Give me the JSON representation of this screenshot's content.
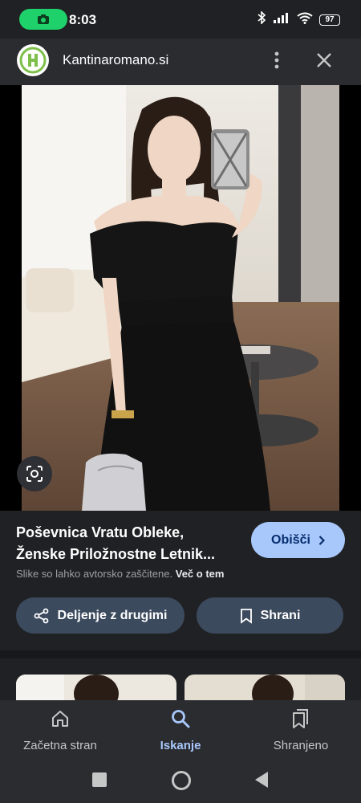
{
  "status_bar": {
    "time": "8:03",
    "battery": "97"
  },
  "header": {
    "site_name": "Kantinaromano.si"
  },
  "result": {
    "title_line1": "Poševnica Vratu Obleke,",
    "title_line2": "Ženske Priložnostne Letnik...",
    "visit_label": "Obišči",
    "copyright_text": "Slike so lahko avtorsko zaščitene.",
    "copyright_link": "Več o tem",
    "share_label": "Deljenje z drugimi",
    "save_label": "Shrani"
  },
  "bottom_nav": [
    {
      "label": "Začetna stran",
      "icon": "home-icon",
      "active": false
    },
    {
      "label": "Iskanje",
      "icon": "search-icon",
      "active": true
    },
    {
      "label": "Shranjeno",
      "icon": "saved-icon",
      "active": false
    }
  ],
  "colors": {
    "accent": "#a8c7fa",
    "background": "#202124",
    "button": "#3c4a5e"
  }
}
